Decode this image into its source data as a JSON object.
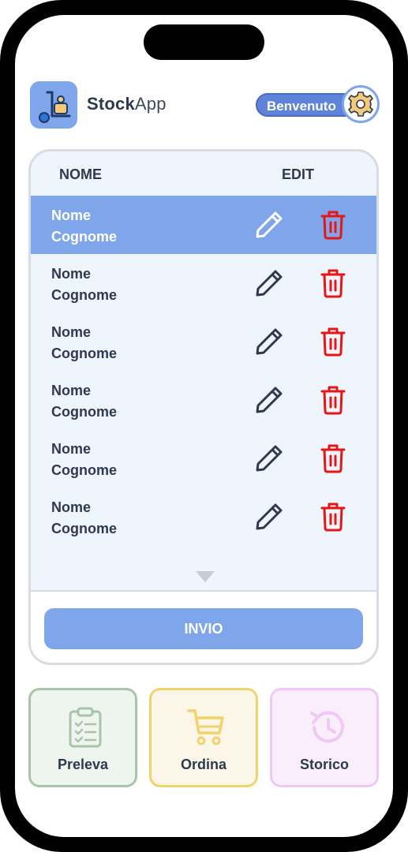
{
  "app": {
    "name_bold": "Stock",
    "name_light": "App"
  },
  "header": {
    "welcome_label": "Benvenuto"
  },
  "table": {
    "columns": [
      "NOME",
      "EDIT"
    ],
    "rows": [
      {
        "first": "Nome",
        "last": "Cognome",
        "selected": true
      },
      {
        "first": "Nome",
        "last": "Cognome",
        "selected": false
      },
      {
        "first": "Nome",
        "last": "Cognome",
        "selected": false
      },
      {
        "first": "Nome",
        "last": "Cognome",
        "selected": false
      },
      {
        "first": "Nome",
        "last": "Cognome",
        "selected": false
      },
      {
        "first": "Nome",
        "last": "Cognome",
        "selected": false
      }
    ]
  },
  "actions": {
    "send_label": "INVIO"
  },
  "nav": [
    {
      "label": "Preleva",
      "icon": "clipboard-icon"
    },
    {
      "label": "Ordina",
      "icon": "cart-icon"
    },
    {
      "label": "Storico",
      "icon": "history-icon"
    }
  ],
  "colors": {
    "accent": "#7fa6ea",
    "delete": "#e81515",
    "text": "#2d3a4e"
  }
}
